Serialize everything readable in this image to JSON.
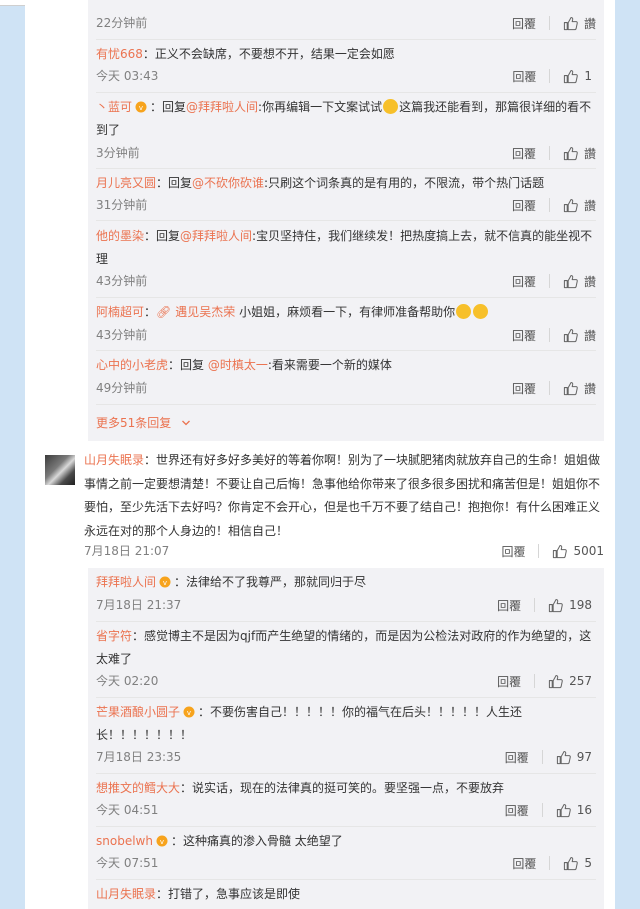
{
  "colors": {
    "accent": "#eb7350",
    "bg": "#cfe3f5",
    "reply_bg": "#f2f2f5",
    "muted": "#808080"
  },
  "labels": {
    "reply": "回覆",
    "like_icon": "thumb-up-icon"
  },
  "top_replies": [
    {
      "time": "22分钟前",
      "likes": "讚"
    },
    {
      "user": "有忧668",
      "sep": "：",
      "text": "正义不会缺席，不要想不开，结果一定会如愿",
      "time": "今天 03:43",
      "likes": "1"
    },
    {
      "user": "丶蓝可",
      "sep": "：回复",
      "mention": "@拜拜啦人间",
      "text_a": ":你再编辑一下文案试试",
      "text_b": "这篇我还能看到，那篇很详细的看不到了",
      "time": "3分钟前",
      "likes": "讚"
    },
    {
      "user": "月儿亮又圆",
      "sep": "：回复",
      "mention": "@不砍你砍谁",
      "text": ":只刷这个词条真的是有用的，不限流，带个热门话题",
      "time": "31分钟前",
      "likes": "讚"
    },
    {
      "user": "他的墨染",
      "sep": "：回复",
      "mention": "@拜拜啦人间",
      "text": ":宝贝坚持住，我们继续发！把热度搞上去，就不信真的能坐视不理",
      "time": "43分钟前",
      "likes": "讚"
    },
    {
      "user": "阿楠超可",
      "sep": "：",
      "link": "遇见吴杰荣",
      "text": " 小姐姐，麻烦看一下，有律师准备帮助你",
      "time": "43分钟前",
      "likes": "讚"
    },
    {
      "user": "心中的小老虎",
      "sep": "：回复 ",
      "mention": "@时槙太一",
      "text": ":看来需要一个新的媒体",
      "time": "49分钟前",
      "likes": "讚"
    }
  ],
  "more_replies": "更多51条回复",
  "main_comment": {
    "user": "山月失眠录",
    "sep": "：",
    "text": "世界还有好多好多美好的等着你啊！别为了一块腻肥猪肉就放弃自己的生命！姐姐做事情之前一定要想清楚！不要让自己后悔！急事他给你带来了很多很多困扰和痛苦但是！姐姐你不要怕，至少先活下去好吗？你肯定不会开心，但是也千万不要了结自己！抱抱你！有什么困难正义永远在对的那个人身边的！相信自己！",
    "time": "7月18日 21:07",
    "likes": "5001"
  },
  "sub_replies": [
    {
      "user": "拜拜啦人间",
      "sep": "：",
      "text": "法律给不了我尊严，那就同归于尽",
      "time": "7月18日 21:37",
      "likes": "198"
    },
    {
      "user": "省字符",
      "sep": "：",
      "text": "感觉博主不是因为qjf而产生绝望的情绪的，而是因为公检法对政府的作为绝望的，这太难了",
      "time": "今天 02:20",
      "likes": "257"
    },
    {
      "user": "芒果酒酿小圆子",
      "sep": "：",
      "text": "不要伤害自己！！！！！你的福气在后头！！！！！人生还长！！！！！！！",
      "time": "7月18日 23:35",
      "likes": "97"
    },
    {
      "user": "想推文的鳕大大",
      "sep": "：",
      "text": "说实话，现在的法律真的挺可笑的。要坚强一点，不要放弃",
      "time": "今天 04:51",
      "likes": "16"
    },
    {
      "user": "snobelwh",
      "sep": "：",
      "text": "这种痛真的渗入骨髓 太绝望了",
      "time": "今天 07:51",
      "likes": "5"
    },
    {
      "user": "山月失眠录",
      "sep": "：",
      "text": "打错了，急事应该是即使"
    }
  ]
}
